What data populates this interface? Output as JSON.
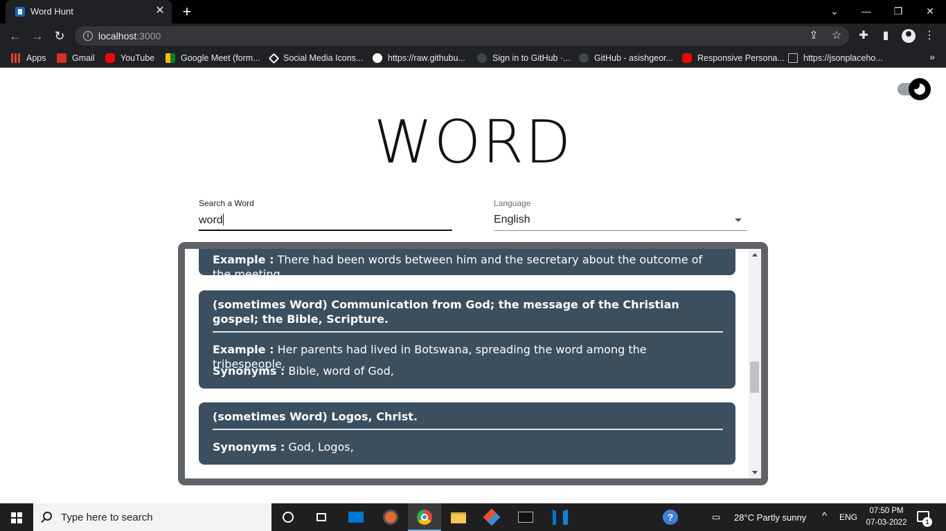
{
  "browser": {
    "tab_title": "Word Hunt",
    "close_glyph": "✕",
    "new_tab_glyph": "+",
    "url_host": "localhost",
    "url_port": ":3000",
    "window_controls": {
      "chevron": "⌄",
      "minimize": "—",
      "restore": "❐",
      "close": "✕"
    },
    "nav": {
      "back": "←",
      "forward": "→",
      "reload": "↻"
    },
    "toolbar_icons": {
      "share": "⇪",
      "star": "☆",
      "extensions": "✚",
      "sidebar": "▮"
    }
  },
  "bookmarks": [
    {
      "label": "Apps",
      "icon": "apps-grid-icon",
      "color": "#ea4335"
    },
    {
      "label": "Gmail",
      "icon": "gmail-icon",
      "color": "#d93025"
    },
    {
      "label": "YouTube",
      "icon": "youtube-icon",
      "color": "#ff0000"
    },
    {
      "label": "Google Meet (form...",
      "icon": "meet-icon",
      "color": "#00832d"
    },
    {
      "label": "Social Media Icons...",
      "icon": "codepen-icon",
      "color": "#ffffff"
    },
    {
      "label": "https://raw.githubu...",
      "icon": "globe-icon",
      "color": "#ffffff"
    },
    {
      "label": "Sign in to GitHub ·...",
      "icon": "github-icon",
      "color": "#6e7681"
    },
    {
      "label": "GitHub - asishgeor...",
      "icon": "github-icon",
      "color": "#6e7681"
    },
    {
      "label": "Responsive Persona...",
      "icon": "youtube-icon",
      "color": "#ff0000"
    },
    {
      "label": "https://jsonplaceho...",
      "icon": "jsonplaceholder-icon",
      "color": "#bdc1c6"
    }
  ],
  "bookmarks_more": "»",
  "app": {
    "title": "WORD",
    "search_label": "Search a Word",
    "search_value": "word",
    "language_label": "Language",
    "language_value": "English"
  },
  "definitions": [
    {
      "example_label": "Example :",
      "example": "There had been words between him and the secretary about the outcome of the meeting."
    },
    {
      "definition": "(sometimes Word) Communication from God; the message of the Christian gospel; the Bible, Scripture.",
      "example_label": "Example :",
      "example": "Her parents had lived in Botswana, spreading the word among the tribespeople.",
      "synonyms_label": "Synonyms :",
      "synonyms": "Bible, word of God,"
    },
    {
      "definition": "(sometimes Word) Logos, Christ.",
      "synonyms_label": "Synonyms :",
      "synonyms": "God, Logos,"
    }
  ],
  "taskbar": {
    "search_placeholder": "Type here to search",
    "weather": "28°C  Partly sunny",
    "language": "ENG",
    "time": "07:50 PM",
    "date": "07-03-2022",
    "notification_count": "1",
    "accent": "#76b9ed"
  }
}
